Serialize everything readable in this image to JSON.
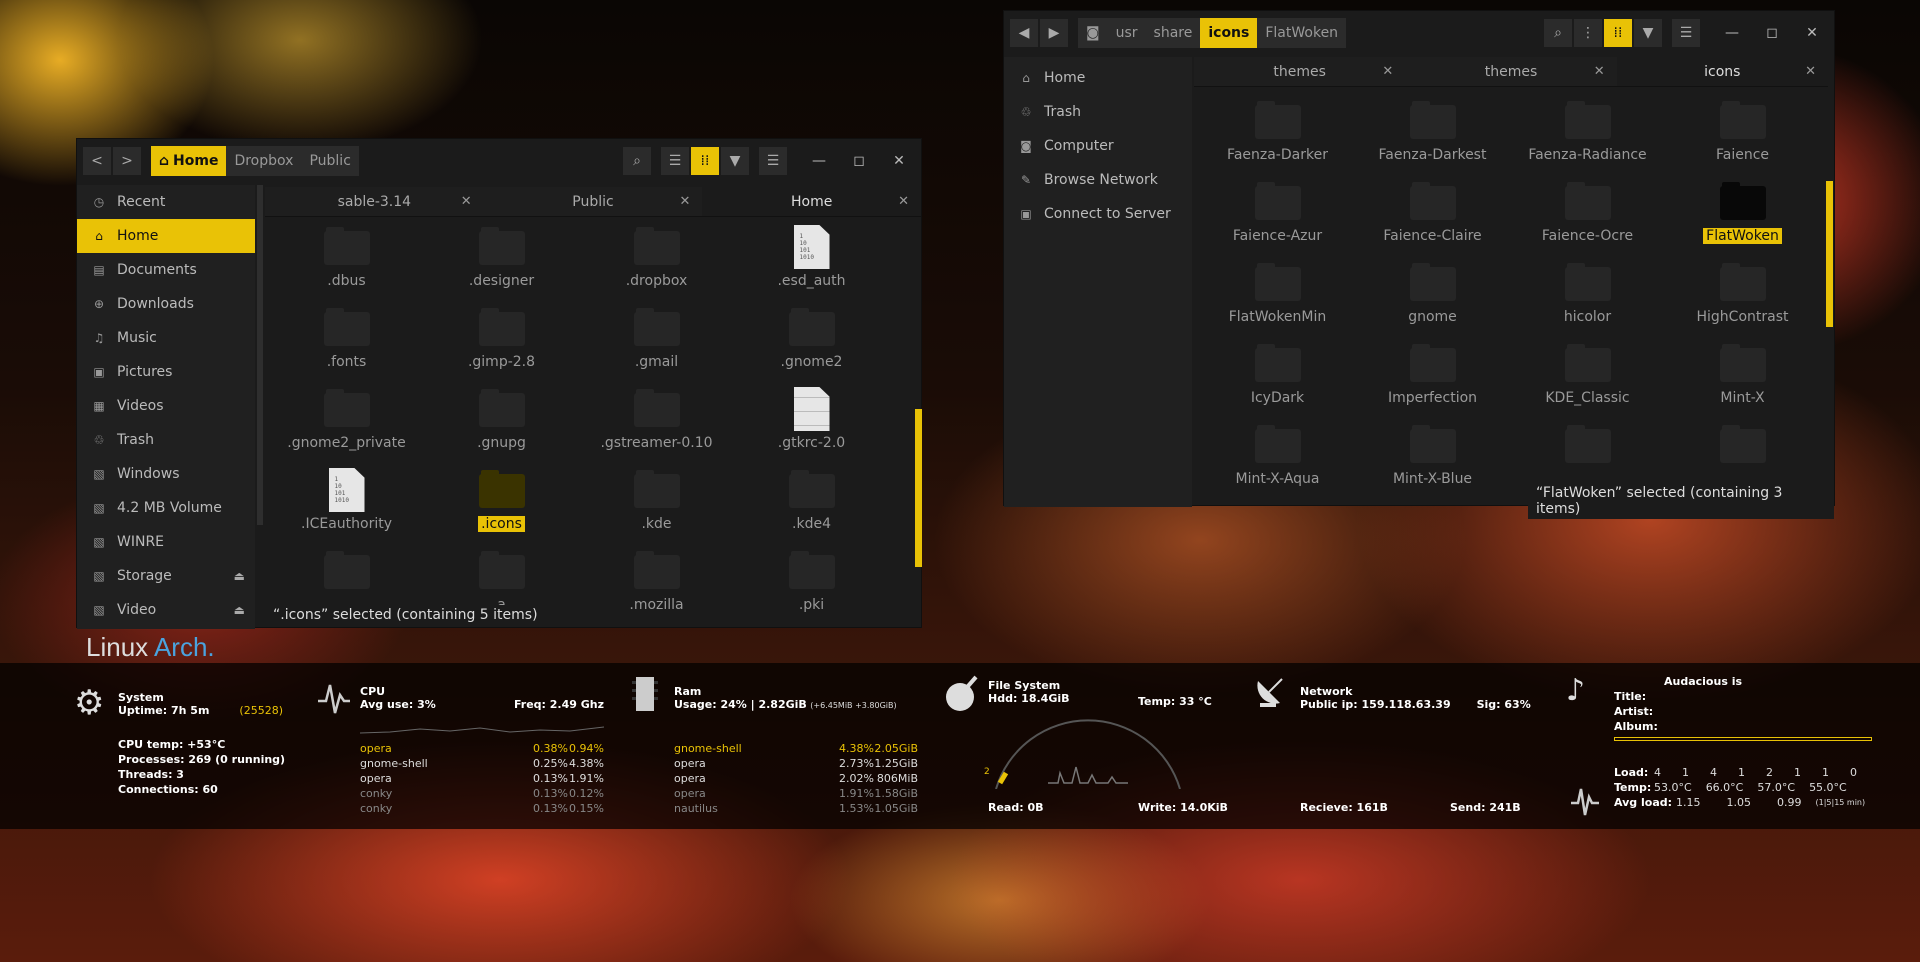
{
  "left_window": {
    "nav": {
      "back": "<",
      "forward": ">"
    },
    "breadcrumb": [
      "Home",
      "Dropbox",
      "Public"
    ],
    "toolbar": {
      "search": "⌕",
      "list": "☰",
      "grid": "⁞⁞",
      "sort": "▼",
      "menu": "☰"
    },
    "wincontrols": {
      "min": "—",
      "max": "◻",
      "close": "✕"
    },
    "sidebar": [
      {
        "label": "Recent",
        "icon": "◷"
      },
      {
        "label": "Home",
        "icon": "⌂"
      },
      {
        "label": "Documents",
        "icon": "▤"
      },
      {
        "label": "Downloads",
        "icon": "⊕"
      },
      {
        "label": "Music",
        "icon": "♫"
      },
      {
        "label": "Pictures",
        "icon": "▣"
      },
      {
        "label": "Videos",
        "icon": "▦"
      },
      {
        "label": "Trash",
        "icon": "♲"
      },
      {
        "label": "Windows",
        "icon": "▧"
      },
      {
        "label": "4.2 MB Volume",
        "icon": "▧"
      },
      {
        "label": "WINRE",
        "icon": "▧"
      },
      {
        "label": "Storage",
        "icon": "▧",
        "eject": "⏏"
      },
      {
        "label": "Video",
        "icon": "▧",
        "eject": "⏏"
      }
    ],
    "tabs": [
      {
        "label": "sable-3.14",
        "close": "✕"
      },
      {
        "label": "Public",
        "close": "✕"
      },
      {
        "label": "Home",
        "close": "✕"
      }
    ],
    "files": [
      {
        "name": ".dbus",
        "kind": "folder"
      },
      {
        "name": ".designer",
        "kind": "folder"
      },
      {
        "name": ".dropbox",
        "kind": "folder"
      },
      {
        "name": ".esd_auth",
        "kind": "bin"
      },
      {
        "name": ".fonts",
        "kind": "folder"
      },
      {
        "name": ".gimp-2.8",
        "kind": "folder"
      },
      {
        "name": ".gmail",
        "kind": "folder"
      },
      {
        "name": ".gnome2",
        "kind": "folder"
      },
      {
        "name": ".gnome2_private",
        "kind": "folder"
      },
      {
        "name": ".gnupg",
        "kind": "folder"
      },
      {
        "name": ".gstreamer-0.10",
        "kind": "folder"
      },
      {
        "name": ".gtkrc-2.0",
        "kind": "txt"
      },
      {
        "name": ".ICEauthority",
        "kind": "bin"
      },
      {
        "name": ".icons",
        "kind": "folder",
        "selected": true
      },
      {
        "name": ".kde",
        "kind": "folder"
      },
      {
        "name": ".kde4",
        "kind": "folder"
      },
      {
        "name": "",
        "kind": "folder"
      },
      {
        "name": "a",
        "kind": "folder"
      },
      {
        "name": ".mozilla",
        "kind": "folder"
      },
      {
        "name": ".pki",
        "kind": "folder"
      }
    ],
    "bin_text": "1\n10\n101\n1010",
    "status": "“.icons” selected (containing 5 items)"
  },
  "right_window": {
    "nav": {
      "back": "◀",
      "forward": "▶"
    },
    "breadcrumb": [
      "usr",
      "share",
      "icons",
      "FlatWoken"
    ],
    "crumb_icon": "◙",
    "toolbar": {
      "search": "⌕",
      "more": "⋮",
      "grid": "⁞⁞",
      "sort": "▼",
      "menu": "☰"
    },
    "wincontrols": {
      "min": "—",
      "max": "◻",
      "close": "✕"
    },
    "sidebar": [
      {
        "label": "Home",
        "icon": "⌂"
      },
      {
        "label": "Trash",
        "icon": "♲"
      },
      {
        "label": "Computer",
        "icon": "◙"
      },
      {
        "label": "Browse Network",
        "icon": "✎"
      },
      {
        "label": "Connect to Server",
        "icon": "▣"
      }
    ],
    "tabs": [
      {
        "label": "themes",
        "close": "✕"
      },
      {
        "label": "themes",
        "close": "✕"
      },
      {
        "label": "icons",
        "close": "✕"
      }
    ],
    "folders": [
      {
        "name": "Faenza-Darker"
      },
      {
        "name": "Faenza-Darkest"
      },
      {
        "name": "Faenza-Radiance"
      },
      {
        "name": "Faience"
      },
      {
        "name": "Faience-Azur"
      },
      {
        "name": "Faience-Claire"
      },
      {
        "name": "Faience-Ocre"
      },
      {
        "name": "FlatWoken",
        "selected": true
      },
      {
        "name": "FlatWokenMin"
      },
      {
        "name": "gnome"
      },
      {
        "name": "hicolor"
      },
      {
        "name": "HighContrast"
      },
      {
        "name": "IcyDark"
      },
      {
        "name": "Imperfection"
      },
      {
        "name": "KDE_Classic"
      },
      {
        "name": "Mint-X"
      },
      {
        "name": "Mint-X-Aqua"
      },
      {
        "name": "Mint-X-Blue"
      },
      {
        "name": ""
      },
      {
        "name": ""
      }
    ],
    "status": "“FlatWoken” selected (containing 3 items)"
  },
  "desktop": {
    "brand": {
      "linux": "Linux",
      "arch": "Arch."
    }
  },
  "conky": {
    "system": {
      "title": "System",
      "uptime": "Uptime: 7h 5m",
      "uptime_extra": "(25528)",
      "cpu_temp": "CPU temp: +53°C",
      "processes": "Processes: 269 (0 running)",
      "threads": "Threads: 3",
      "connections": "Connections: 60",
      "icon": "⚙"
    },
    "cpu": {
      "title": "CPU",
      "avg": "Avg use: 3%",
      "freq": "Freq: 2.49 Ghz",
      "procs": [
        [
          "opera",
          "0.38%",
          "0.94%"
        ],
        [
          "gnome-shell",
          "0.25%",
          "4.38%"
        ],
        [
          "opera",
          "0.13%",
          "1.91%"
        ],
        [
          "conky",
          "0.13%",
          "0.12%"
        ],
        [
          "conky",
          "0.13%",
          "0.15%"
        ]
      ]
    },
    "ram": {
      "title": "Ram",
      "usage": "Usage: 24%  | 2.82GiB",
      "extra": "(+6.45MiB +3.80GiB)",
      "procs": [
        [
          "gnome-shell",
          "4.38%",
          "2.05GiB"
        ],
        [
          "opera",
          "2.73%",
          "1.25GiB"
        ],
        [
          "opera",
          "2.02%",
          "806MiB"
        ],
        [
          "opera",
          "1.91%",
          "1.58GiB"
        ],
        [
          "nautilus",
          "1.53%",
          "1.05GiB"
        ]
      ]
    },
    "fs": {
      "title": "File System",
      "hdd": "Hdd: 18.4GiB",
      "temp": "Temp: 33 °C",
      "read": "Read: 0B",
      "write": "Write: 14.0KiB",
      "gauge_mark": "2"
    },
    "net": {
      "title": "Network",
      "ip": "Public ip: 159.118.63.39",
      "sig": "Sig: 63%",
      "recv": "Recieve: 161B",
      "send": "Send: 241B"
    },
    "audio": {
      "title": "Audacious is",
      "fields": [
        "Title:",
        "Artist:",
        "Album:"
      ],
      "icon": "♪"
    },
    "load": {
      "label": "Load:",
      "values": [
        "4",
        "1",
        "4",
        "1",
        "2",
        "1",
        "1",
        "0"
      ],
      "temp_label": "Temp:",
      "temps": [
        "53.0°C",
        "66.0°C",
        "57.0°C",
        "55.0°C"
      ],
      "avg_label": "Avg load:",
      "avgs": [
        "1.15",
        "1.05",
        "0.99"
      ],
      "avg_note": "(1|5|15 min)"
    }
  }
}
